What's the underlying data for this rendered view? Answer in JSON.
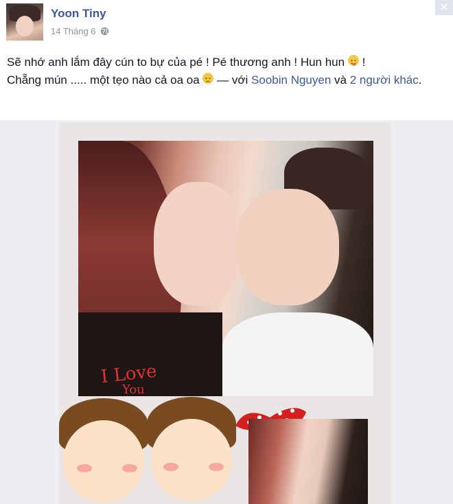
{
  "post": {
    "author": "Yoon Tiny",
    "date": "14 Tháng 6",
    "text_line1": "Sẽ nhớ anh lắm đây cún to bự của pé ! Pé thương anh ! Hun hun",
    "text_line1_end": " !",
    "text_line2_start": "Chẵng mún ..... một tẹo nào cả oa oa",
    "with_sep": " — với ",
    "tag_person": "Soobin Nguyen",
    "and": " và ",
    "tag_others": "2 người khác",
    "period": "."
  },
  "photo": {
    "overlay_text": "I Love",
    "overlay_sub": "You"
  },
  "icons": {
    "privacy": "globe-icon",
    "close": "close-icon",
    "emoji1": "tongue-smile-emoji",
    "emoji2": "sad-emoji"
  },
  "colors": {
    "link": "#3b5998",
    "meta": "#90949c",
    "text": "#141823"
  }
}
